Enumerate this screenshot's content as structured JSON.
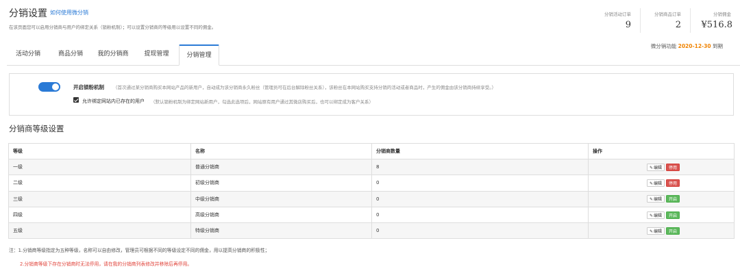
{
  "header": {
    "title": "分销设置",
    "help_link": "如何使用微分销",
    "description": "在该页面您可以启用分销商与用户的绑定关系（锁粉机制）；可以设置分销商的等级用以设置不同的佣金。"
  },
  "stats": [
    {
      "label": "分销活动订单",
      "value": "9"
    },
    {
      "label": "分销商品订单",
      "value": "2"
    },
    {
      "label": "分销佣金",
      "value": "¥516.8"
    }
  ],
  "expire": {
    "prefix": "微分销功能",
    "date": "2020-12-30",
    "suffix": "到期"
  },
  "tabs": [
    {
      "label": "活动分销",
      "active": false
    },
    {
      "label": "商品分销",
      "active": false
    },
    {
      "label": "我的分销商",
      "active": false
    },
    {
      "label": "提现管理",
      "active": false
    },
    {
      "label": "分销管理",
      "active": true
    }
  ],
  "settings": {
    "lock_fans": {
      "label": "开启锁粉机制",
      "enabled": true,
      "note": "（首次通过某分销商购买本网站产品的新用户，自动成为该分销商永久粉丝（管理员可在后台解除粉丝关系），该粉丝在本网站购买支持分销的活动或者商品时，产生的佣金由该分销商持续享受。）"
    },
    "allow_existing": {
      "label": "允许绑定网站内已存在的用户",
      "checked": true,
      "note": "（默认锁粉机制为绑定网站新用户，勾选此选项后，网站原有用户通过其微店购买后，也可以绑定成为客户关系）"
    }
  },
  "levels_section": {
    "title": "分销商等级设置",
    "columns": [
      "等级",
      "名称",
      "分销商数量",
      "操作"
    ],
    "rows": [
      {
        "level": "一级",
        "name": "普通分销商",
        "count": "8",
        "edit": "编辑",
        "toggle": "停用",
        "toggle_type": "disable"
      },
      {
        "level": "二级",
        "name": "初级分销商",
        "count": "0",
        "edit": "编辑",
        "toggle": "停用",
        "toggle_type": "disable"
      },
      {
        "level": "三级",
        "name": "中级分销商",
        "count": "0",
        "edit": "编辑",
        "toggle": "开启",
        "toggle_type": "enable"
      },
      {
        "level": "四级",
        "name": "高级分销商",
        "count": "0",
        "edit": "编辑",
        "toggle": "开启",
        "toggle_type": "enable"
      },
      {
        "level": "五级",
        "name": "特级分销商",
        "count": "0",
        "edit": "编辑",
        "toggle": "开启",
        "toggle_type": "enable"
      }
    ]
  },
  "notes": {
    "line1": "注：1.分销商等级指定为五种等级，名称可以自由修改，管理员可根据不同的等级设定不同的佣金，用以提高分销商的积极性；",
    "line2": "2.分销商等级下存在分销商时无法停用，请在我的分销商列表修改并移除后再停用。"
  },
  "colors": {
    "accent": "#2a7ad6",
    "expire_date": "#f08300",
    "disable": "#d9534f",
    "enable": "#5cb85c",
    "warning_note": "#e0433a"
  },
  "icons": {
    "edit": "pencil-icon",
    "check": "checkmark-icon"
  }
}
